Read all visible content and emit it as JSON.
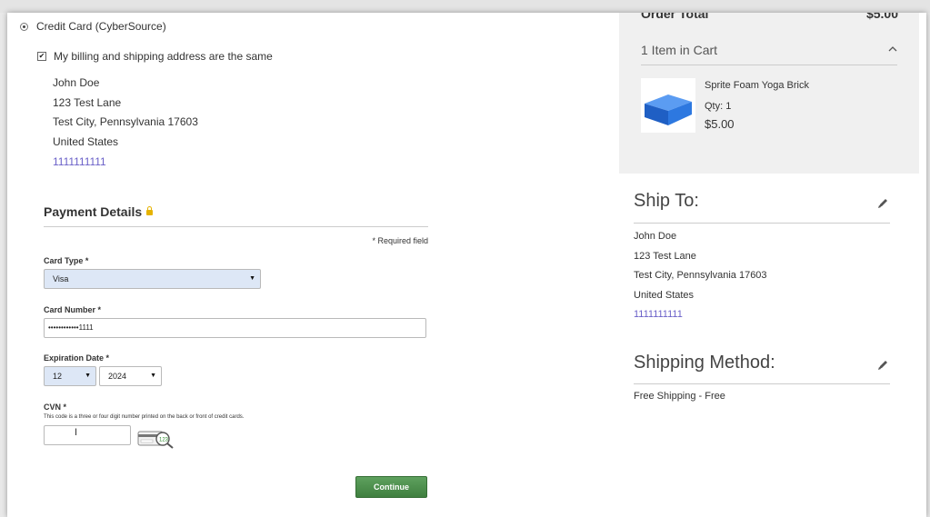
{
  "payment": {
    "method_label": "Credit Card (CyberSource)",
    "same_address_label": "My billing and shipping address are the same",
    "billing_address": {
      "name": "John Doe",
      "street": "123 Test Lane",
      "city_state_zip": "Test City, Pennsylvania 17603",
      "country": "United States",
      "phone": "1111111111"
    },
    "details_title": "Payment Details",
    "required_note": "* Required field",
    "card_type": {
      "label": "Card Type *",
      "value": "Visa"
    },
    "card_number": {
      "label": "Card Number *",
      "value": "••••••••••••1111"
    },
    "expiration": {
      "label": "Expiration Date *",
      "month": "12",
      "year": "2024"
    },
    "cvn": {
      "label": "CVN *",
      "help": "This code is a three or four digit number printed on the back or front of credit cards.",
      "card_icon_text": "123"
    },
    "continue_label": "Continue"
  },
  "summary": {
    "order_total_label": "Order Total",
    "order_total_value": "$5.00",
    "cart_count_label": "1 Item in Cart",
    "item": {
      "name": "Sprite Foam Yoga Brick",
      "qty": "Qty: 1",
      "price": "$5.00"
    }
  },
  "ship_to": {
    "title": "Ship To:",
    "name": "John Doe",
    "street": "123 Test Lane",
    "city_state_zip": "Test City, Pennsylvania 17603",
    "country": "United States",
    "phone": "1111111111"
  },
  "shipping_method": {
    "title": "Shipping Method:",
    "value": "Free Shipping - Free"
  },
  "colors": {
    "accent_link": "#6a60c8",
    "continue_button": "#4a8f4a",
    "card_type_bg": "#dde7f6",
    "summary_bg": "#f0f0f0"
  }
}
